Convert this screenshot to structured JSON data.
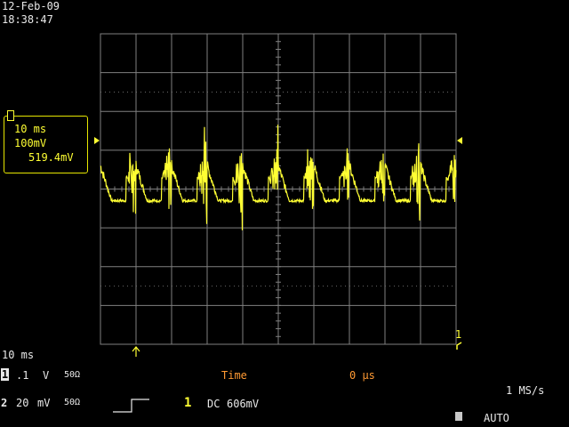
{
  "header": {
    "date": "12-Feb-09",
    "time": "18:38:47"
  },
  "channel_box": {
    "timebase": "10 ms",
    "volts_per_div": "100mV",
    "offset": "519.4mV"
  },
  "bottom": {
    "timebase": "10 ms",
    "ch1_number": "1",
    "ch1_scale": ".1",
    "ch1_unit": "V",
    "ch1_impedance": "50Ω",
    "ch2_number": "2",
    "ch2_scale": "20",
    "ch2_unit": "mV",
    "ch2_impedance": "50Ω",
    "time_label": "Time",
    "time_value": "0 μs",
    "trigger_channel": "1",
    "trigger_coupling": "DC",
    "trigger_level": "606mV",
    "sample_rate": "1 MS/s",
    "trigger_mode": "AUTO"
  },
  "markers": {
    "right_trace_marker": "1"
  },
  "colors": {
    "trace": "#ffff33",
    "grid": "#808080",
    "time_text": "#ff9a33",
    "text": "#e8e8e8"
  },
  "waveform": {
    "periods_per_screen": 10,
    "peak_divisions": [
      2.2,
      2.2,
      2.35,
      2.4,
      1.6,
      2.2,
      1.3,
      1.7,
      2.1,
      1.6
    ]
  }
}
